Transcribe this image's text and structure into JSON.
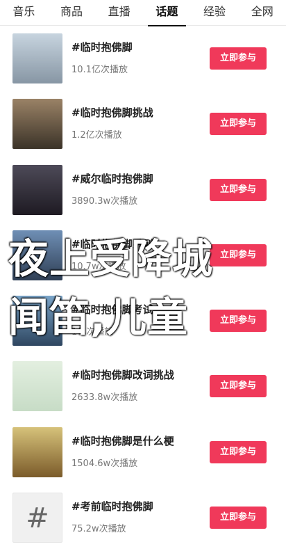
{
  "tabs": [
    {
      "label": "音乐",
      "active": false
    },
    {
      "label": "商品",
      "active": false
    },
    {
      "label": "直播",
      "active": false
    },
    {
      "label": "话题",
      "active": true
    },
    {
      "label": "经验",
      "active": false
    },
    {
      "label": "全网",
      "active": false
    }
  ],
  "topics": [
    {
      "title": "#临时抱佛脚",
      "plays": "10.1亿次播放",
      "button": "立即参与",
      "thumb": "gray"
    },
    {
      "title": "#临时抱佛脚挑战",
      "plays": "1.2亿次播放",
      "button": "立即参与",
      "thumb": "man"
    },
    {
      "title": "#威尔临时抱佛脚",
      "plays": "3890.3w次播放",
      "button": "立即参与",
      "thumb": "dark"
    },
    {
      "title": "#临时抱佛脚系列",
      "plays": "10.7w次播放",
      "button": "立即参与",
      "thumb": "sky"
    },
    {
      "title": "#临时抱佛脚考试",
      "plays": "1亿次播放",
      "button": "立即参与",
      "thumb": "blue"
    },
    {
      "title": "#临时抱佛脚改词挑战",
      "plays": "2633.8w次播放",
      "button": "立即参与",
      "thumb": "map"
    },
    {
      "title": "#临时抱佛脚是什么梗",
      "plays": "1504.6w次播放",
      "button": "立即参与",
      "thumb": "yellow"
    },
    {
      "title": "#考前临时抱佛脚",
      "plays": "75.2w次播放",
      "button": "立即参与",
      "thumb": "hash"
    }
  ],
  "overlay": {
    "line1": "夜上受降城",
    "line2": "闻笛,儿童"
  },
  "colors": {
    "button": "#f0395a",
    "accent": "#111111"
  }
}
